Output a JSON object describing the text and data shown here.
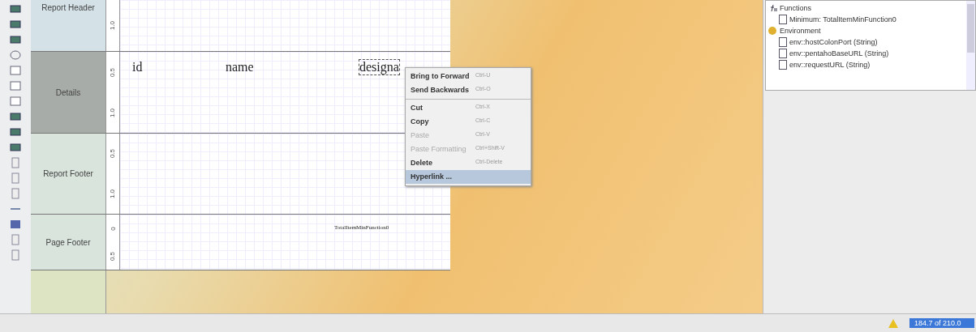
{
  "bands": [
    {
      "label": "Report Header",
      "selected": false,
      "ruler_labels": [
        "1.0"
      ]
    },
    {
      "label": "Details",
      "selected": true,
      "ruler_labels": [
        "0.5",
        "1.0"
      ],
      "fields": [
        {
          "text": "id",
          "kind": "large",
          "selected": false
        },
        {
          "text": "name",
          "kind": "large",
          "selected": false
        },
        {
          "text": "designa",
          "kind": "large",
          "selected": true
        }
      ]
    },
    {
      "label": "Report Footer",
      "selected": false,
      "ruler_labels": [
        "0.5",
        "1.0"
      ]
    },
    {
      "label": "Page Footer",
      "selected": false,
      "ruler_labels": [
        "0",
        "0.5"
      ],
      "fields": [
        {
          "text": "TotalItemMinFunction0",
          "kind": "small",
          "selected": false
        }
      ]
    }
  ],
  "context_menu": [
    {
      "kind": "item",
      "label": "Bring to Forward",
      "shortcut": "Ctrl-U",
      "disabled": false,
      "selected": false
    },
    {
      "kind": "item",
      "label": "Send Backwards",
      "shortcut": "Ctrl-O",
      "disabled": false,
      "selected": false
    },
    {
      "kind": "separator"
    },
    {
      "kind": "item",
      "label": "Cut",
      "shortcut": "Ctrl-X",
      "disabled": false,
      "selected": false
    },
    {
      "kind": "item",
      "label": "Copy",
      "shortcut": "Ctrl-C",
      "disabled": false,
      "selected": false
    },
    {
      "kind": "item",
      "label": "Paste",
      "shortcut": "Ctrl-V",
      "disabled": true,
      "selected": false
    },
    {
      "kind": "item",
      "label": "Paste Formatting",
      "shortcut": "Ctrl+Shift-V",
      "disabled": true,
      "selected": false
    },
    {
      "kind": "item",
      "label": "Delete",
      "shortcut": "Ctrl-Delete",
      "disabled": false,
      "selected": false
    },
    {
      "kind": "item",
      "label": "Hyperlink ...",
      "disabled": false,
      "selected": true
    }
  ],
  "tree": [
    {
      "label": "Functions",
      "kind": "functions",
      "children": [
        {
          "label": "Minimum: TotalItemMinFunction0",
          "kind": "leaf"
        }
      ]
    },
    {
      "label": "Environment",
      "kind": "folder",
      "children": [
        {
          "label": "env::hostColonPort (String)",
          "kind": "leaf"
        },
        {
          "label": "env::pentahoBaseURL (String)",
          "kind": "leaf"
        },
        {
          "label": "env::requestURL (String)",
          "kind": "leaf"
        }
      ]
    }
  ],
  "status_bar": {
    "memory": "184.7 of 210.0"
  }
}
